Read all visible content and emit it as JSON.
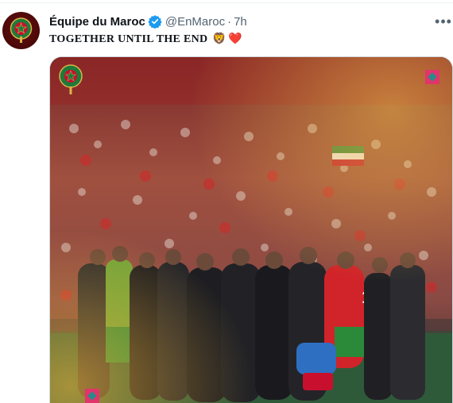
{
  "tweet": {
    "display_name": "Équipe du Maroc",
    "handle": "@EnMaroc",
    "separator": "·",
    "time": "7h",
    "more_label": "•••",
    "text": "TOGETHER UNTIL THE END",
    "emoji": [
      "🦁",
      "❤️"
    ]
  },
  "icons": {
    "verified": "verified-badge-icon",
    "more": "more-options-icon",
    "avatar": "morocco-crest-avatar",
    "corner_marks": "diamond-logo-icon"
  },
  "colors": {
    "verified_blue": "#1d9bf0",
    "muted_text": "#536471",
    "jersey_red": "#c8102e",
    "jersey_green": "#2a8a3a",
    "avatar_bg": "#5a0b0b",
    "diamond": "#e0356b"
  },
  "media": {
    "player_number": "16"
  }
}
